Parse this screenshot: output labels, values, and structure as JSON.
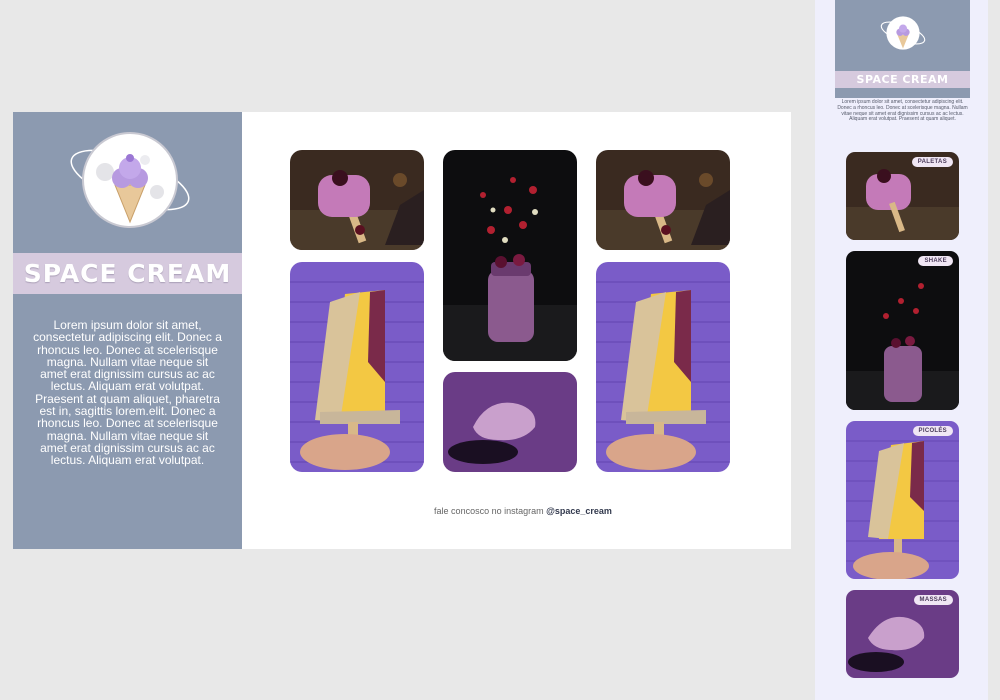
{
  "brand": {
    "title": "SPACE CREAM",
    "description": "Lorem ipsum dolor sit amet, consectetur adipiscing elit. Donec a rhoncus leo. Donec at scelerisque magna. Nullam vitae neque sit amet erat dignissim cursus ac ac lectus. Aliquam erat volutpat. Praesent at quam aliquet, pharetra est in, sagittis lorem.elit. Donec a rhoncus leo. Donec at scelerisque magna. Nullam vitae neque sit amet erat dignissim cursus ac ac lectus. Aliquam erat volutpat."
  },
  "footer": {
    "text": "fale concosco no instagram ",
    "handle": "@space_cream"
  },
  "mobile": {
    "title": "SPACE CREAM",
    "description": "Lorem ipsum dolor sit amet, consectetur adipiscing elit. Donec a rhoncus leo. Donec at scelerisque magna. Nullam vitae neque sit amet erat dignissim cursus ac ac lectus. Aliquam erat volutpat. Praesent at quam aliquet.",
    "cards": [
      {
        "badge": "PALETAS"
      },
      {
        "badge": "SHAKE"
      },
      {
        "badge": "PICOLÉS"
      },
      {
        "badge": "MASSAS"
      }
    ]
  },
  "colors": {
    "sidebar": "#8c9ab0",
    "brand_bar": "#d6cade",
    "mobile_bg": "#efeffc"
  }
}
